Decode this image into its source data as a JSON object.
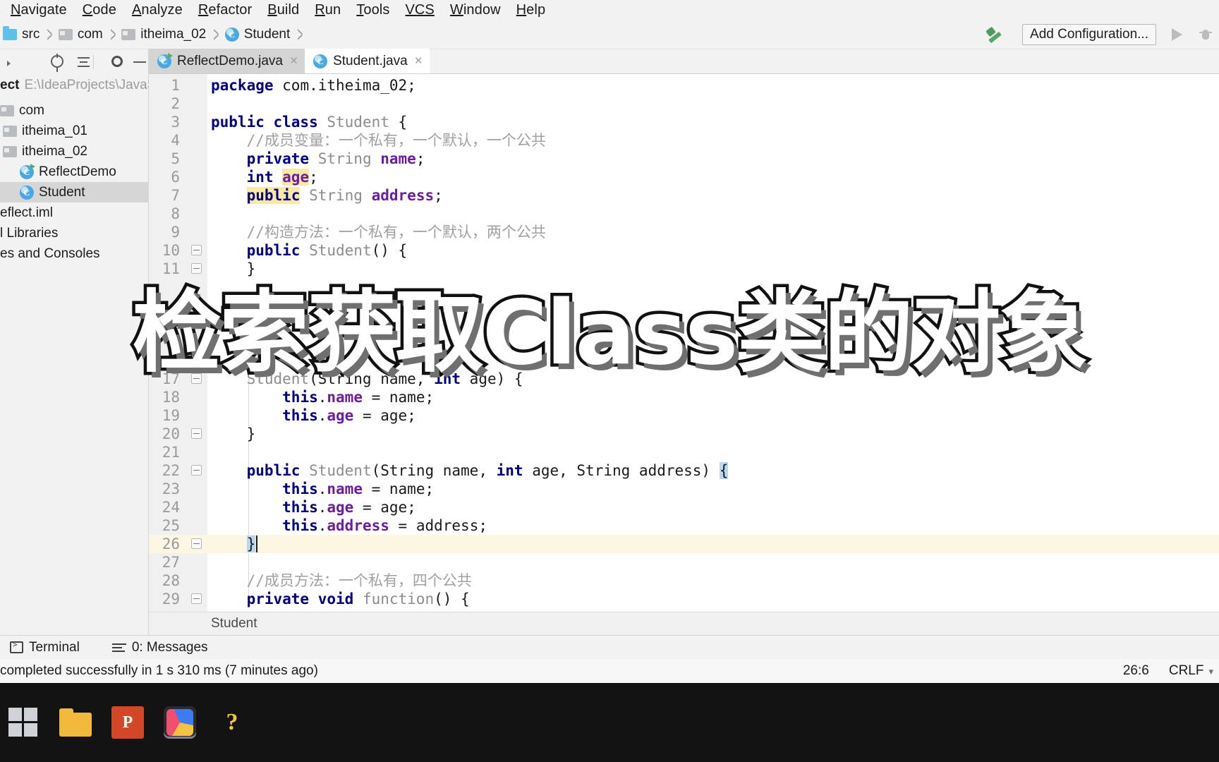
{
  "menubar": {
    "items": [
      {
        "mnemonic": "N",
        "rest": "avigate"
      },
      {
        "mnemonic": "C",
        "rest": "ode"
      },
      {
        "mnemonic": "A",
        "rest": "nalyze"
      },
      {
        "mnemonic": "R",
        "rest": "efactor"
      },
      {
        "mnemonic": "B",
        "rest": "uild"
      },
      {
        "mnemonic": "R",
        "rest": "un"
      },
      {
        "mnemonic": "T",
        "rest": "ools"
      },
      {
        "mnemonic": "VCS",
        "rest": ""
      },
      {
        "mnemonic": "W",
        "rest": "indow"
      },
      {
        "mnemonic": "H",
        "rest": "elp"
      }
    ]
  },
  "navbar": {
    "crumbs": [
      {
        "label": "src",
        "icon": "folder-blue-icon"
      },
      {
        "label": "com",
        "icon": "folder-gray-icon"
      },
      {
        "label": "itheima_02",
        "icon": "folder-gray-icon"
      },
      {
        "label": "Student",
        "icon": "class-icon"
      }
    ],
    "separator": ">",
    "build_icon": "hammer-icon",
    "add_configuration": "Add Configuration...",
    "run_icon": "run-icon",
    "debug_icon": "debug-icon"
  },
  "project_tool": {
    "title": "ect",
    "path": "E:\\IdeaProjects\\JavaSE",
    "tree": [
      {
        "label": "com",
        "icon": "folder-gray-icon",
        "indent": 0,
        "selected": false
      },
      {
        "label": "itheima_01",
        "icon": "folder-gray-icon",
        "indent": 1,
        "selected": false
      },
      {
        "label": "itheima_02",
        "icon": "folder-gray-icon",
        "indent": 1,
        "selected": false
      },
      {
        "label": "ReflectDemo",
        "icon": "class-run-icon",
        "indent": 2,
        "selected": false
      },
      {
        "label": "Student",
        "icon": "class-icon",
        "indent": 2,
        "selected": true
      },
      {
        "label": "eflect.iml",
        "icon": "none",
        "indent": 0,
        "selected": false
      },
      {
        "label": "l Libraries",
        "icon": "none",
        "indent": 0,
        "selected": false
      },
      {
        "label": "es and Consoles",
        "icon": "none",
        "indent": 0,
        "selected": false
      }
    ]
  },
  "tabs": [
    {
      "label": "ReflectDemo.java",
      "icon": "class-run-icon",
      "active": false,
      "close": "×"
    },
    {
      "label": "Student.java",
      "icon": "class-icon",
      "active": true,
      "close": "×"
    }
  ],
  "editor": {
    "breadcrumb": "Student",
    "lines": [
      {
        "n": 1,
        "segments": [
          {
            "t": "package ",
            "c": "kw"
          },
          {
            "t": "com.itheima_02;",
            "c": "plain"
          }
        ]
      },
      {
        "n": 2,
        "segments": []
      },
      {
        "n": 3,
        "segments": [
          {
            "t": "public class ",
            "c": "kw"
          },
          {
            "t": "Student ",
            "c": "cls"
          },
          {
            "t": "{",
            "c": "plain"
          }
        ]
      },
      {
        "n": 4,
        "segments": [
          {
            "t": "    //成员变量：一个私有，一个默认，一个公共",
            "c": "cmt"
          }
        ]
      },
      {
        "n": 5,
        "segments": [
          {
            "t": "    ",
            "c": "plain"
          },
          {
            "t": "private ",
            "c": "kw"
          },
          {
            "t": "String ",
            "c": "cls"
          },
          {
            "t": "name",
            "c": "fld"
          },
          {
            "t": ";",
            "c": "plain"
          }
        ]
      },
      {
        "n": 6,
        "segments": [
          {
            "t": "    ",
            "c": "plain"
          },
          {
            "t": "int ",
            "c": "kw"
          },
          {
            "t": "age",
            "c": "fld hl-search"
          },
          {
            "t": ";",
            "c": "plain"
          }
        ]
      },
      {
        "n": 7,
        "segments": [
          {
            "t": "    ",
            "c": "plain"
          },
          {
            "t": "public",
            "c": "kw hl-search"
          },
          {
            "t": " ",
            "c": "plain"
          },
          {
            "t": "String ",
            "c": "cls"
          },
          {
            "t": "address",
            "c": "fld"
          },
          {
            "t": ";",
            "c": "plain"
          }
        ]
      },
      {
        "n": 8,
        "segments": []
      },
      {
        "n": 9,
        "segments": [
          {
            "t": "    //构造方法：一个私有，一个默认，两个公共",
            "c": "cmt"
          }
        ]
      },
      {
        "n": 10,
        "segments": [
          {
            "t": "    ",
            "c": "plain"
          },
          {
            "t": "public ",
            "c": "kw"
          },
          {
            "t": "Student",
            "c": "cls"
          },
          {
            "t": "() {",
            "c": "plain"
          }
        ],
        "fold": true
      },
      {
        "n": 11,
        "segments": [
          {
            "t": "    }",
            "c": "plain"
          }
        ],
        "fold": true
      },
      {
        "n": 17,
        "segments": [
          {
            "t": "    Student",
            "c": "cls"
          },
          {
            "t": "(String name, ",
            "c": "plain"
          },
          {
            "t": "int ",
            "c": "kw"
          },
          {
            "t": "age) {",
            "c": "plain"
          }
        ],
        "fold": true
      },
      {
        "n": 18,
        "segments": [
          {
            "t": "        ",
            "c": "plain"
          },
          {
            "t": "this",
            "c": "kw"
          },
          {
            "t": ".",
            "c": "plain"
          },
          {
            "t": "name",
            "c": "fld"
          },
          {
            "t": " = name;",
            "c": "plain"
          }
        ]
      },
      {
        "n": 19,
        "segments": [
          {
            "t": "        ",
            "c": "plain"
          },
          {
            "t": "this",
            "c": "kw"
          },
          {
            "t": ".",
            "c": "plain"
          },
          {
            "t": "age",
            "c": "fld"
          },
          {
            "t": " = age;",
            "c": "plain"
          }
        ]
      },
      {
        "n": 20,
        "segments": [
          {
            "t": "    }",
            "c": "plain"
          }
        ],
        "fold": true
      },
      {
        "n": 21,
        "segments": []
      },
      {
        "n": 22,
        "segments": [
          {
            "t": "    ",
            "c": "plain"
          },
          {
            "t": "public ",
            "c": "kw"
          },
          {
            "t": "Student",
            "c": "cls"
          },
          {
            "t": "(String name, ",
            "c": "plain"
          },
          {
            "t": "int ",
            "c": "kw"
          },
          {
            "t": "age, String address) ",
            "c": "plain"
          },
          {
            "t": "{",
            "c": "plain brace-hl"
          }
        ],
        "fold": true
      },
      {
        "n": 23,
        "segments": [
          {
            "t": "        ",
            "c": "plain"
          },
          {
            "t": "this",
            "c": "kw"
          },
          {
            "t": ".",
            "c": "plain"
          },
          {
            "t": "name",
            "c": "fld"
          },
          {
            "t": " = name;",
            "c": "plain"
          }
        ]
      },
      {
        "n": 24,
        "segments": [
          {
            "t": "        ",
            "c": "plain"
          },
          {
            "t": "this",
            "c": "kw"
          },
          {
            "t": ".",
            "c": "plain"
          },
          {
            "t": "age",
            "c": "fld"
          },
          {
            "t": " = age;",
            "c": "plain"
          }
        ]
      },
      {
        "n": 25,
        "segments": [
          {
            "t": "        ",
            "c": "plain"
          },
          {
            "t": "this",
            "c": "kw"
          },
          {
            "t": ".",
            "c": "plain"
          },
          {
            "t": "address",
            "c": "fld"
          },
          {
            "t": " = address;",
            "c": "plain"
          }
        ]
      },
      {
        "n": 26,
        "segments": [
          {
            "t": "    ",
            "c": "plain"
          },
          {
            "t": "}",
            "c": "plain brace-hl"
          }
        ],
        "fold": true,
        "current": true,
        "caret": true
      },
      {
        "n": 27,
        "segments": []
      },
      {
        "n": 28,
        "segments": [
          {
            "t": "    //成员方法：一个私有，四个公共",
            "c": "cmt"
          }
        ]
      },
      {
        "n": 29,
        "segments": [
          {
            "t": "    ",
            "c": "plain"
          },
          {
            "t": "private void ",
            "c": "kw"
          },
          {
            "t": "function",
            "c": "cls"
          },
          {
            "t": "() {",
            "c": "plain"
          }
        ],
        "fold": true
      }
    ]
  },
  "bottom_tools": [
    {
      "label": "Terminal",
      "icon": "terminal-icon"
    },
    {
      "label": "0: Messages",
      "icon": "messages-icon",
      "mnemonic": "0"
    }
  ],
  "statusbar": {
    "message": "completed successfully in 1 s 310 ms (7 minutes ago)",
    "position": "26:6",
    "line_separator": "CRLF"
  },
  "overlay": {
    "subtitle": "检索获取Class类的对象"
  },
  "taskbar": {
    "items": [
      {
        "name": "windows-start-icon"
      },
      {
        "name": "file-explorer-icon"
      },
      {
        "name": "powerpoint-icon",
        "label": "P"
      },
      {
        "name": "intellij-idea-icon",
        "active": true
      },
      {
        "name": "question-app-icon",
        "label": "?"
      }
    ]
  },
  "colors": {
    "keyword": "#000080",
    "field": "#6b1f9e",
    "comment": "#a0a0a0",
    "class": "#8c8c8c",
    "current_line": "#fdf6e3",
    "search_highlight": "#fbe8a6",
    "selection": "#b9d5f0",
    "accent_green": "#59a869"
  }
}
